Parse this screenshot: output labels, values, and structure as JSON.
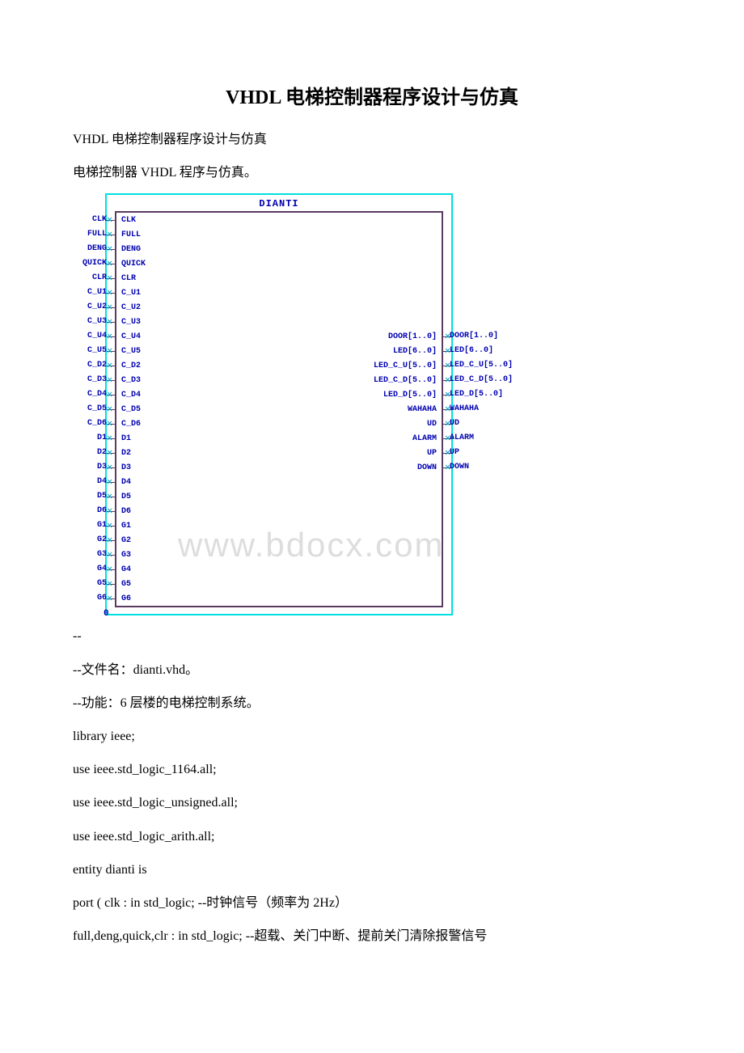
{
  "title": "VHDL 电梯控制器程序设计与仿真",
  "intro1": "VHDL 电梯控制器程序设计与仿真",
  "intro2": "电梯控制器 VHDL 程序与仿真。",
  "diagram": {
    "title": "DIANTI",
    "zero": "0",
    "leftPorts": [
      "CLK",
      "FULL",
      "DENG",
      "QUICK",
      "CLR",
      "C_U1",
      "C_U2",
      "C_U3",
      "C_U4",
      "C_U5",
      "C_D2",
      "C_D3",
      "C_D4",
      "C_D5",
      "C_D6",
      "D1",
      "D2",
      "D3",
      "D4",
      "D5",
      "D6",
      "G1",
      "G2",
      "G3",
      "G4",
      "G5",
      "G6"
    ],
    "rightPorts": [
      {
        "row": 8,
        "label": "DOOR[1..0]"
      },
      {
        "row": 9,
        "label": "LED[6..0]"
      },
      {
        "row": 10,
        "label": "LED_C_U[5..0]"
      },
      {
        "row": 11,
        "label": "LED_C_D[5..0]"
      },
      {
        "row": 12,
        "label": "LED_D[5..0]"
      },
      {
        "row": 13,
        "label": "WAHAHA"
      },
      {
        "row": 14,
        "label": "UD"
      },
      {
        "row": 15,
        "label": "ALARM"
      },
      {
        "row": 16,
        "label": "UP"
      },
      {
        "row": 17,
        "label": "DOWN"
      }
    ]
  },
  "watermark": "www.bdocx.com",
  "code": {
    "l0": "--",
    "l1": "--文件名：dianti.vhd。",
    "l2": "--功能：6 层楼的电梯控制系统。",
    "l3": "library ieee;",
    "l4": "use ieee.std_logic_1164.all;",
    "l5": "use ieee.std_logic_unsigned.all;",
    "l6": "use ieee.std_logic_arith.all;",
    "l7": "entity dianti is",
    "l8": "port ( clk : in std_logic; --时钟信号（频率为 2Hz）",
    "l9": " full,deng,quick,clr : in std_logic; --超载、关门中断、提前关门清除报警信号"
  }
}
